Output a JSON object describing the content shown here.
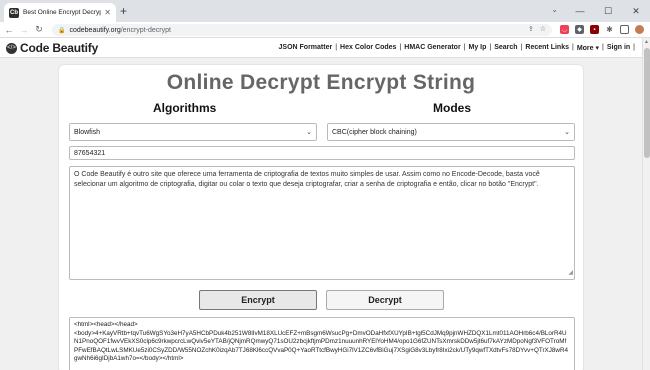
{
  "browser": {
    "tab_title": "Best Online Encrypt Decrypt Tool",
    "tab_favicon": "Cb",
    "new_tab": "+",
    "url_domain": "codebeautify.org",
    "url_path": "/encrypt-decrypt",
    "icons": [
      "back-icon",
      "forward-icon",
      "reload-icon",
      "lock-icon",
      "share-icon",
      "star-icon",
      "pocket-icon",
      "shield-icon",
      "extension-icon",
      "puzzle-icon",
      "side-panel-icon",
      "avatar",
      "kebab-menu-icon"
    ]
  },
  "site": {
    "logo_text": "Code Beautify",
    "nav": [
      "JSON Formatter",
      "Hex Color Codes",
      "HMAC Generator",
      "My Ip",
      "Search",
      "Recent Links",
      "More ▾",
      "Sign in"
    ]
  },
  "main": {
    "title": "Online Decrypt Encrypt String",
    "algorithms_heading": "Algorithms",
    "modes_heading": "Modes",
    "algorithm_selected": "Blowfish",
    "mode_selected": "CBC(cipher block chaining)",
    "key_value": "87654321",
    "input_text": "O Code Beautify é outro site que oferece uma ferramenta de criptografia de textos muito simples de usar. Assim como no Encode-Decode, basta você selecionar um algoritmo de criptografia, digitar ou colar o texto que deseja criptografar, criar a senha de criptografia e então, clicar no botão \"Encrypt\".",
    "encrypt_label": "Encrypt",
    "decrypt_label": "Decrypt",
    "output_text": "<html><head></head>\n<body>4+KayVRtb+tqvTu6WgSYo3eH7yA5HCbPDuk4b251W8lIvM18XLUcEFZ+mBsgm6WsucPg+DmvODaHfxfXUYpIB+tgl5CdJMq9pjnWHZDQX1Lmt011AOHrb6c4/BLorR4UN1PnoQOF1fwvVEkXS0clp6c9rkwpcrcLwQviv5eYTAB/jQNjmRQmwyQ71sOU2zbcjkftjmPDmz1nuuunhRYElYoHM4/opo1G6fZUNTsXmrskDDw5jt6uf7kAYzMDpoNgf3VFOTroMfPFwEfBAQtLwLSMKUe5zi0CSyZDD/W55NOZchK0izqAb7TJ68Kl6ccQVvaP0Q+YaoRTtcfBwyHGi7lV1ZC6vfBiGuj7XSgiG8v3Lbyfr8Ixi2ck/UTy9qwfTXdtvFs78DYvv+QTrXJ8wR4gwNh6i6gIDjbA1wh7o=</body></html>"
  },
  "colors": {
    "title": "#666666",
    "page_bg": "#f0f0f0",
    "chrome_bg": "#dee1e6"
  }
}
